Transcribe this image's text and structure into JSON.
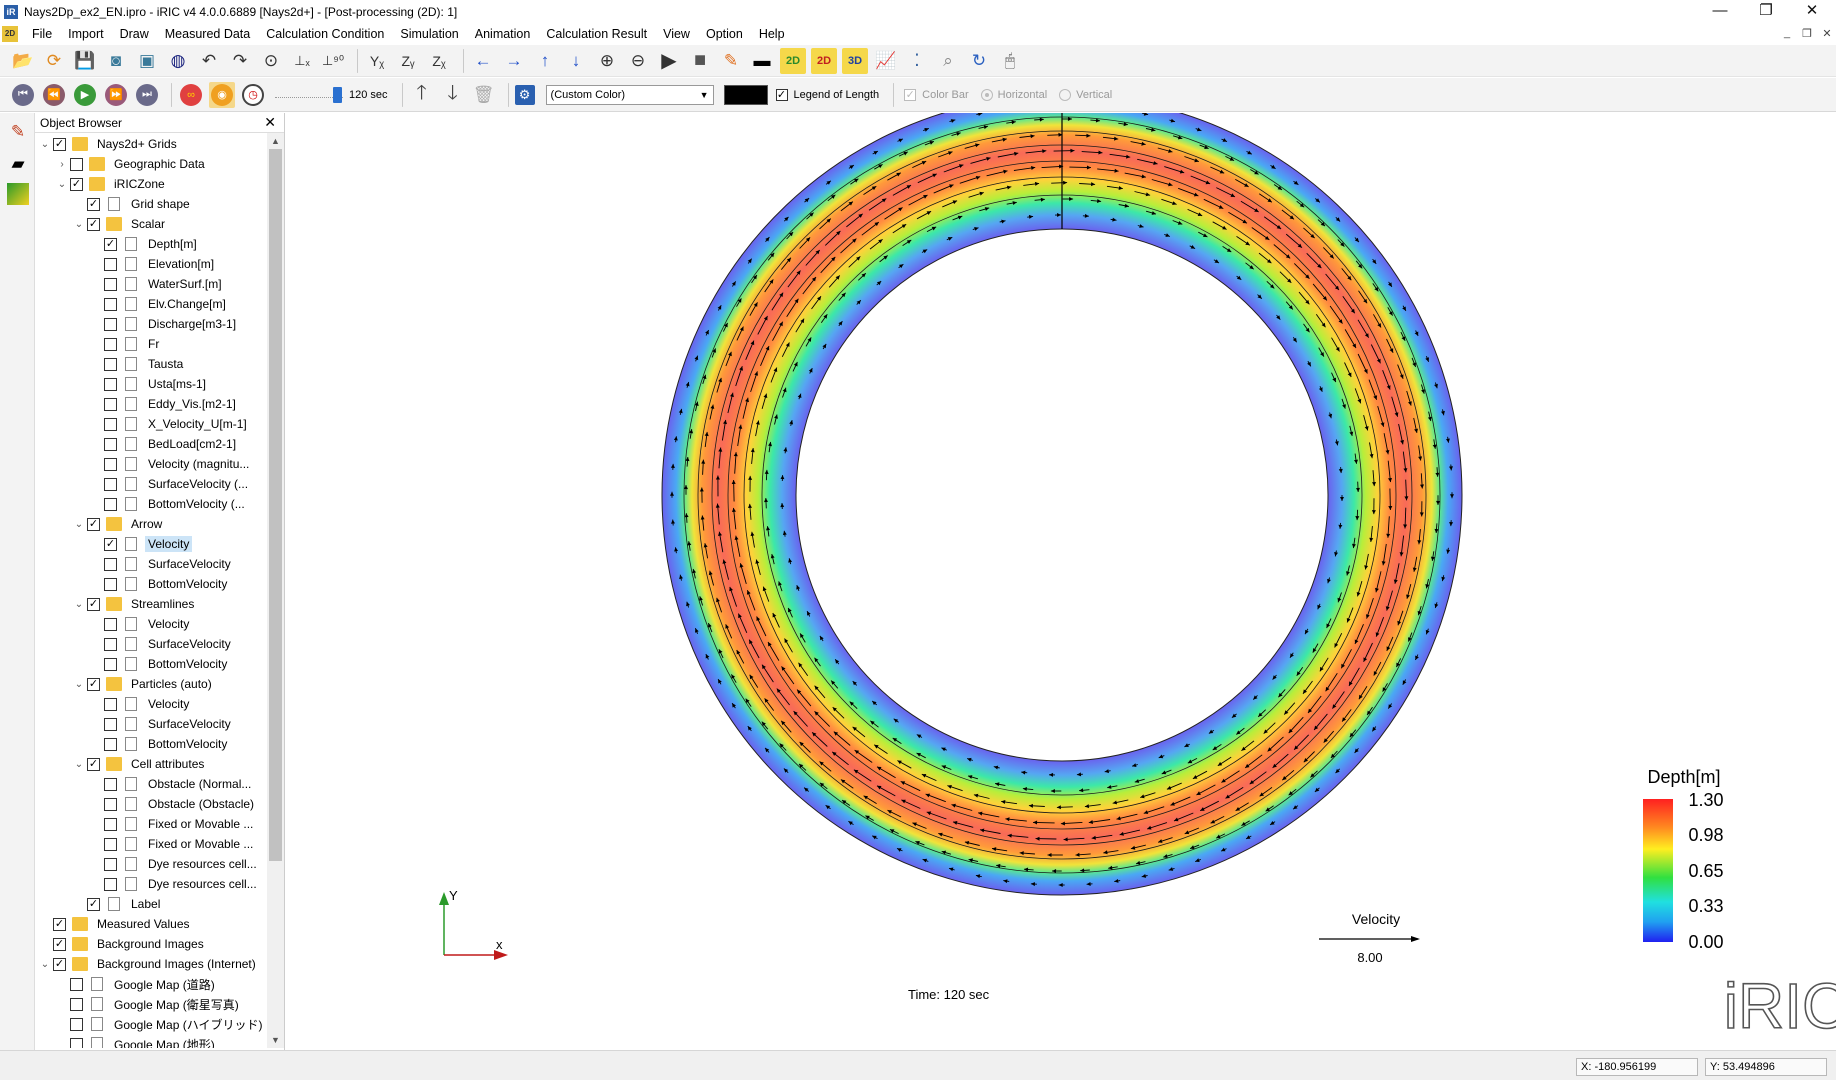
{
  "window": {
    "title": "Nays2Dp_ex2_EN.ipro - iRIC v4 4.0.0.6889 [Nays2d+] - [Post-processing (2D): 1]",
    "minimize": "—",
    "restore": "❐",
    "close": "✕"
  },
  "menus": [
    "File",
    "Import",
    "Draw",
    "Measured Data",
    "Calculation Condition",
    "Simulation",
    "Animation",
    "Calculation Result",
    "View",
    "Option",
    "Help"
  ],
  "toolbar2": {
    "time": "120 sec",
    "color_select": "(Custom Color)",
    "legend_of_length": "Legend of Length",
    "color_bar": "Color Bar",
    "horizontal": "Horizontal",
    "vertical": "Vertical"
  },
  "object_browser": {
    "title": "Object Browser",
    "tree": [
      {
        "label": "Nays2d+ Grids",
        "checked": true,
        "type": "folder",
        "twisty": "open"
      },
      {
        "label": "Geographic Data",
        "checked": false,
        "type": "folder",
        "twisty": "closed"
      },
      {
        "label": "iRICZone",
        "checked": true,
        "type": "folder",
        "twisty": "open"
      },
      {
        "label": "Grid shape",
        "checked": true,
        "type": "file"
      },
      {
        "label": "Scalar",
        "checked": true,
        "type": "folder",
        "twisty": "open"
      },
      {
        "label": "Depth[m]",
        "checked": true,
        "type": "file"
      },
      {
        "label": "Elevation[m]",
        "checked": false,
        "type": "file"
      },
      {
        "label": "WaterSurf.[m]",
        "checked": false,
        "type": "file"
      },
      {
        "label": "Elv.Change[m]",
        "checked": false,
        "type": "file"
      },
      {
        "label": "Discharge[m3-1]",
        "checked": false,
        "type": "file"
      },
      {
        "label": "Fr",
        "checked": false,
        "type": "file"
      },
      {
        "label": "Tausta",
        "checked": false,
        "type": "file"
      },
      {
        "label": "Usta[ms-1]",
        "checked": false,
        "type": "file"
      },
      {
        "label": "Eddy_Vis.[m2-1]",
        "checked": false,
        "type": "file"
      },
      {
        "label": "X_Velocity_U[m-1]",
        "checked": false,
        "type": "file"
      },
      {
        "label": "BedLoad[cm2-1]",
        "checked": false,
        "type": "file"
      },
      {
        "label": "Velocity (magnitu...",
        "checked": false,
        "type": "file"
      },
      {
        "label": "SurfaceVelocity (...",
        "checked": false,
        "type": "file"
      },
      {
        "label": "BottomVelocity (...",
        "checked": false,
        "type": "file"
      },
      {
        "label": "Arrow",
        "checked": true,
        "type": "folder",
        "twisty": "open"
      },
      {
        "label": "Velocity",
        "checked": true,
        "type": "file",
        "selected": true
      },
      {
        "label": "SurfaceVelocity",
        "checked": false,
        "type": "file"
      },
      {
        "label": "BottomVelocity",
        "checked": false,
        "type": "file"
      },
      {
        "label": "Streamlines",
        "checked": true,
        "type": "folder",
        "twisty": "open"
      },
      {
        "label": "Velocity",
        "checked": false,
        "type": "file"
      },
      {
        "label": "SurfaceVelocity",
        "checked": false,
        "type": "file"
      },
      {
        "label": "BottomVelocity",
        "checked": false,
        "type": "file"
      },
      {
        "label": "Particles (auto)",
        "checked": true,
        "type": "folder",
        "twisty": "open"
      },
      {
        "label": "Velocity",
        "checked": false,
        "type": "file"
      },
      {
        "label": "SurfaceVelocity",
        "checked": false,
        "type": "file"
      },
      {
        "label": "BottomVelocity",
        "checked": false,
        "type": "file"
      },
      {
        "label": "Cell attributes",
        "checked": true,
        "type": "folder",
        "twisty": "open"
      },
      {
        "label": "Obstacle (Normal...",
        "checked": false,
        "type": "file"
      },
      {
        "label": "Obstacle (Obstacle)",
        "checked": false,
        "type": "file"
      },
      {
        "label": "Fixed or Movable ...",
        "checked": false,
        "type": "file"
      },
      {
        "label": "Fixed or Movable ...",
        "checked": false,
        "type": "file"
      },
      {
        "label": "Dye resources cell...",
        "checked": false,
        "type": "file"
      },
      {
        "label": "Dye resources cell...",
        "checked": false,
        "type": "file"
      },
      {
        "label": "Label",
        "checked": true,
        "type": "file"
      },
      {
        "label": "Measured Values",
        "checked": true,
        "type": "folder"
      },
      {
        "label": "Background Images",
        "checked": true,
        "type": "folder"
      },
      {
        "label": "Background Images (Internet)",
        "checked": true,
        "type": "folder",
        "twisty": "open"
      },
      {
        "label": "Google Map (道路)",
        "checked": false,
        "type": "file"
      },
      {
        "label": "Google Map (衛星写真)",
        "checked": false,
        "type": "file"
      },
      {
        "label": "Google Map (ハイブリッド)",
        "checked": false,
        "type": "file"
      },
      {
        "label": "Google Map (地形)",
        "checked": false,
        "type": "file"
      }
    ]
  },
  "viewport": {
    "time_label": "Time:  120 sec",
    "axis_x": "x",
    "axis_y": "Y",
    "velocity_legend_title": "Velocity",
    "velocity_legend_value": "8.00",
    "colorbar_title": "Depth[m]",
    "colorbar_ticks": [
      "1.30",
      "0.98",
      "0.65",
      "0.33",
      "0.00"
    ],
    "logo": "iRIC"
  },
  "status": {
    "x": "X: -180.956199",
    "y": "Y: 53.494896"
  },
  "colors": {
    "toolbar_bg": "#f3f3f3",
    "folder": "#f4c33f",
    "selection": "#cce4f7",
    "depth_low": "#4a3cf2",
    "depth_high": "#ff3b2f"
  }
}
